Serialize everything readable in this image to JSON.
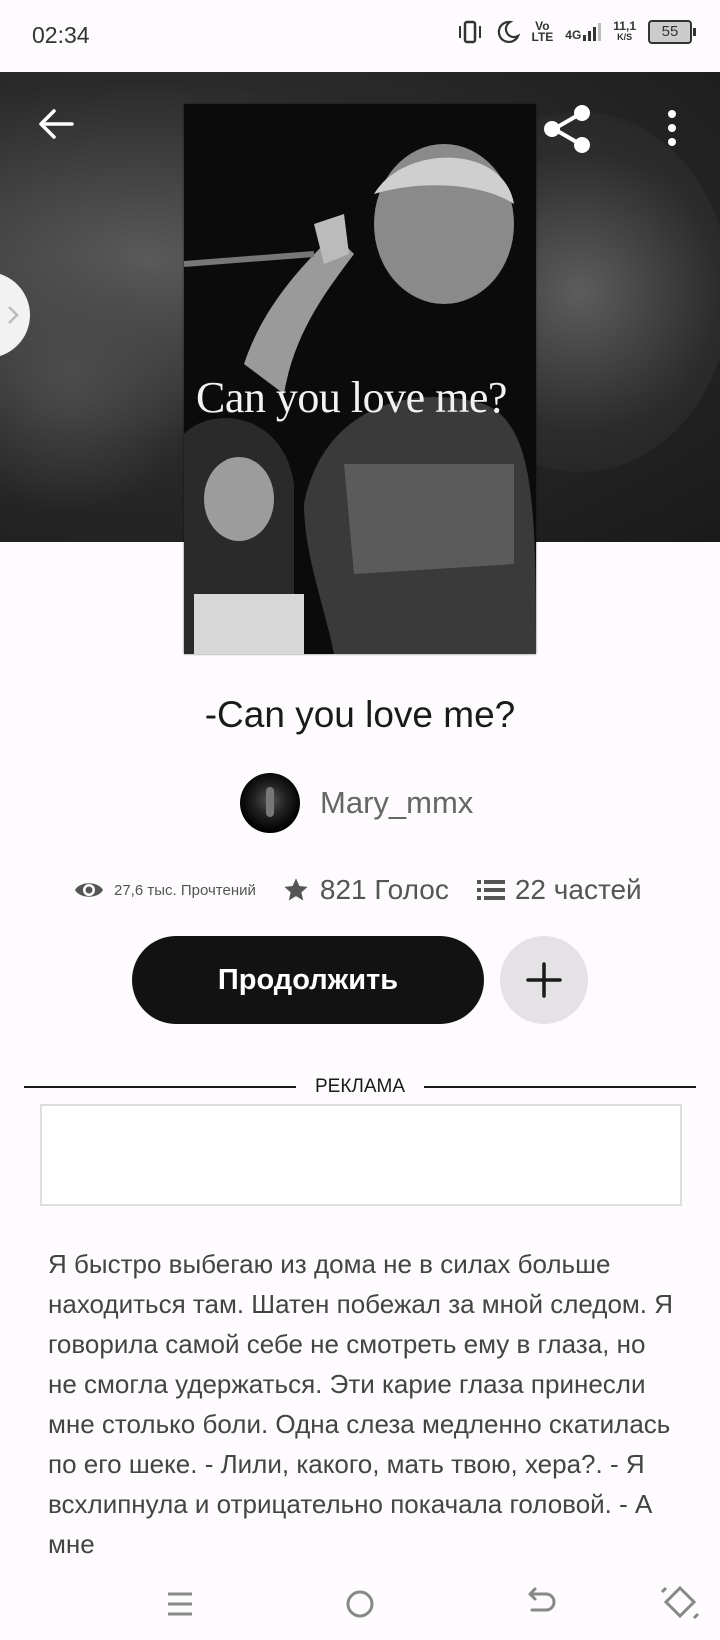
{
  "status_bar": {
    "time": "02:34",
    "volte": "Vo\nLTE",
    "network": "4G",
    "speed_value": "11,1",
    "speed_unit": "K/S",
    "battery": "55"
  },
  "header": {
    "back_icon": "arrow-left-icon",
    "share_icon": "share-icon",
    "more_icon": "more-vertical-icon"
  },
  "cover": {
    "overlay_text": "Can you love me?"
  },
  "book": {
    "title": "-Can you love me?",
    "author": "Mary_mmx"
  },
  "stats": {
    "reads": "27,6 тыс. Прочтений",
    "votes": "821 Голос",
    "parts": "22 частей"
  },
  "actions": {
    "continue_label": "Продолжить"
  },
  "ad": {
    "label": "РЕКЛАМА"
  },
  "excerpt": "Я быстро выбегаю из дома не в силах больше находиться там. Шатен побежал за мной следом. Я говорила самой себе не смотреть ему в глаза, но не смогла удержаться. Эти карие глаза принесли мне столько боли. Одна слеза медленно скатилась по его шеке. - Лили, какого, мать твою, хера?. - Я всхлипнула и отрицательно покачала головой. - А мне",
  "colors": {
    "primary_button": "#121212",
    "secondary_button": "#e4e2e4",
    "background": "#fdfbfd"
  }
}
